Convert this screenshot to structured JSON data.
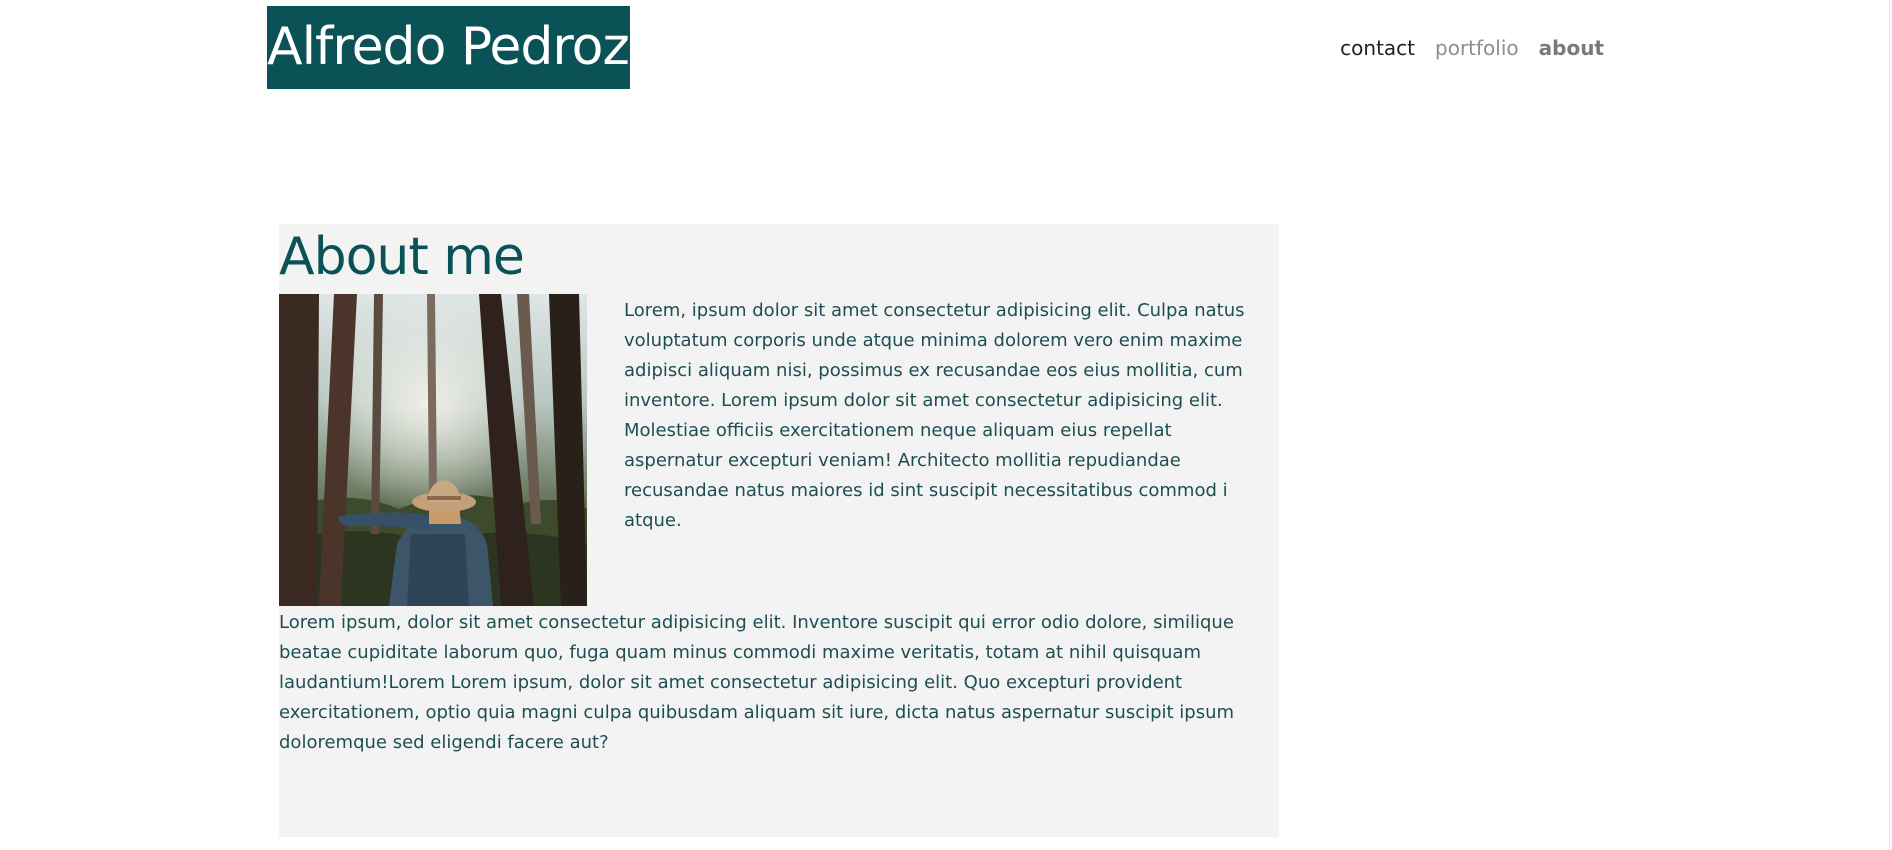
{
  "header": {
    "logo_text": "Alfredo Pedroza",
    "nav": {
      "contact": "contact",
      "portfolio": "portfolio",
      "about": "about"
    }
  },
  "about": {
    "title": "About me",
    "photo_alt": "Person in hat standing in a forest",
    "intro": "Lorem, ipsum dolor sit amet consectetur adipisicing elit. Culpa natus voluptatum corporis unde atque minima dolorem vero enim maxime adipisci aliquam nisi, possimus ex recusandae eos eius mollitia, cum inventore. Lorem ipsum dolor sit amet consectetur adipisicing elit. Molestiae officiis exercitationem neque aliquam eius repellat aspernatur excepturi veniam! Architecto mollitia repudiandae recusandae natus maiores id sint suscipit necessitatibus commod i atque.",
    "body": "Lorem ipsum, dolor sit amet consectetur adipisicing elit. Inventore suscipit qui error odio dolore, similique beatae cupiditate laborum quo, fuga quam minus commodi maxime veritatis, totam at nihil quisquam laudantium!Lorem Lorem ipsum, dolor sit amet consectetur adipisicing elit. Quo excepturi provident exercitationem, optio quia magni culpa quibusdam aliquam sit iure, dicta natus aspernatur suscipit ipsum doloremque sed eligendi facere aut?"
  },
  "colors": {
    "brand": "#0b5257",
    "text": "#1d4f52",
    "section_bg": "#f3f3f3"
  }
}
